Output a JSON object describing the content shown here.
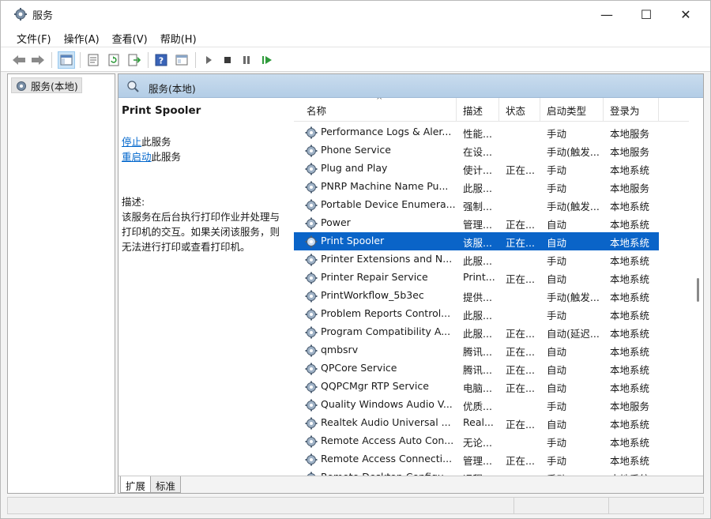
{
  "window": {
    "title": "服务",
    "minimize": "—",
    "maximize": "☐",
    "close": "✕"
  },
  "menu": {
    "items": [
      "文件(F)",
      "操作(A)",
      "查看(V)",
      "帮助(H)"
    ]
  },
  "toolbar": {
    "icons": [
      "back-icon",
      "forward-icon",
      "console-tree-icon",
      "properties-icon",
      "refresh-icon",
      "export-icon",
      "help-icon",
      "view-icon",
      "start-icon",
      "stop-icon",
      "pause-icon",
      "restart-icon"
    ]
  },
  "tree": {
    "root_label": "服务(本地)"
  },
  "main": {
    "header_title": "服务(本地)",
    "selected_service_title": "Print Spooler",
    "stop_link": "停止",
    "stop_suffix": "此服务",
    "restart_link": "重启动",
    "restart_suffix": "此服务",
    "description_label": "描述:",
    "description_lines": [
      "该服务在后台执行打印作业并处理与",
      "打印机的交互。如果关闭该服务，则",
      "无法进行打印或查看打印机。"
    ]
  },
  "columns": {
    "name": "名称",
    "description": "描述",
    "status": "状态",
    "startup_type": "启动类型",
    "logon_as": "登录为"
  },
  "rows": [
    {
      "name": "Performance Logs & Aler...",
      "desc": "性能...",
      "status": "",
      "startup": "手动",
      "logon": "本地服务"
    },
    {
      "name": "Phone Service",
      "desc": "在设...",
      "status": "",
      "startup": "手动(触发...",
      "logon": "本地服务"
    },
    {
      "name": "Plug and Play",
      "desc": "使计...",
      "status": "正在...",
      "startup": "手动",
      "logon": "本地系统"
    },
    {
      "name": "PNRP Machine Name Pu...",
      "desc": "此服...",
      "status": "",
      "startup": "手动",
      "logon": "本地服务"
    },
    {
      "name": "Portable Device Enumera...",
      "desc": "强制...",
      "status": "",
      "startup": "手动(触发...",
      "logon": "本地系统"
    },
    {
      "name": "Power",
      "desc": "管理...",
      "status": "正在...",
      "startup": "自动",
      "logon": "本地系统"
    },
    {
      "name": "Print Spooler",
      "desc": "该服...",
      "status": "正在...",
      "startup": "自动",
      "logon": "本地系统",
      "selected": true
    },
    {
      "name": "Printer Extensions and N...",
      "desc": "此服...",
      "status": "",
      "startup": "手动",
      "logon": "本地系统"
    },
    {
      "name": "Printer Repair Service",
      "desc": "Print...",
      "status": "正在...",
      "startup": "自动",
      "logon": "本地系统"
    },
    {
      "name": "PrintWorkflow_5b3ec",
      "desc": "提供...",
      "status": "",
      "startup": "手动(触发...",
      "logon": "本地系统"
    },
    {
      "name": "Problem Reports Control...",
      "desc": "此服...",
      "status": "",
      "startup": "手动",
      "logon": "本地系统"
    },
    {
      "name": "Program Compatibility A...",
      "desc": "此服...",
      "status": "正在...",
      "startup": "自动(延迟...",
      "logon": "本地系统"
    },
    {
      "name": "qmbsrv",
      "desc": "腾讯...",
      "status": "正在...",
      "startup": "自动",
      "logon": "本地系统"
    },
    {
      "name": "QPCore Service",
      "desc": "腾讯...",
      "status": "正在...",
      "startup": "自动",
      "logon": "本地系统"
    },
    {
      "name": "QQPCMgr RTP Service",
      "desc": "电脑...",
      "status": "正在...",
      "startup": "自动",
      "logon": "本地系统"
    },
    {
      "name": "Quality Windows Audio V...",
      "desc": "优质...",
      "status": "",
      "startup": "手动",
      "logon": "本地服务"
    },
    {
      "name": "Realtek Audio Universal ...",
      "desc": "Real...",
      "status": "正在...",
      "startup": "自动",
      "logon": "本地系统"
    },
    {
      "name": "Remote Access Auto Con...",
      "desc": "无论...",
      "status": "",
      "startup": "手动",
      "logon": "本地系统"
    },
    {
      "name": "Remote Access Connecti...",
      "desc": "管理...",
      "status": "正在...",
      "startup": "手动",
      "logon": "本地系统"
    },
    {
      "name": "Remote Desktop Configu...",
      "desc": "远程...",
      "status": "",
      "startup": "手动",
      "logon": "本地系统"
    }
  ],
  "tabs": {
    "extended": "扩展",
    "standard": "标准"
  },
  "colors": {
    "selection": "#0a64c8",
    "header": "#b3cde6",
    "link": "#0066cc"
  }
}
